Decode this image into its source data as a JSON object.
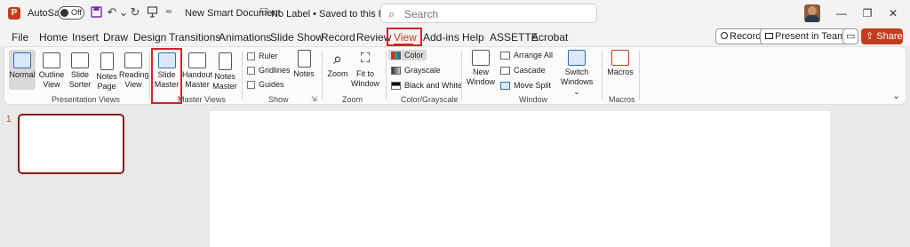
{
  "titlebar": {
    "app_icon": "powerpoint-icon",
    "autosave_label": "AutoSave",
    "autosave_state": "Off",
    "doc_title": "New Smart Document",
    "label_status": "No Label • Saved to this PC ⌄",
    "search_placeholder": "Search"
  },
  "tabs": [
    "File",
    "Home",
    "Insert",
    "Draw",
    "Design",
    "Transitions",
    "Animations",
    "Slide Show",
    "Record",
    "Review",
    "View",
    "Add-ins",
    "Help",
    "ASSETTE",
    "Acrobat"
  ],
  "active_tab": "View",
  "right_buttons": {
    "record": "Record",
    "present_in_teams": "Present in Teams",
    "share": "Share"
  },
  "ribbon": {
    "presentation_views": {
      "label": "Presentation Views",
      "normal": "Normal",
      "outline_view": [
        "Outline",
        "View"
      ],
      "slide_sorter": [
        "Slide",
        "Sorter"
      ],
      "notes_page": [
        "Notes",
        "Page"
      ],
      "reading_view": [
        "Reading",
        "View"
      ]
    },
    "master_views": {
      "label": "Master Views",
      "slide_master": [
        "Slide",
        "Master"
      ],
      "handout_master": [
        "Handout",
        "Master"
      ],
      "notes_master": [
        "Notes",
        "Master"
      ]
    },
    "show": {
      "label": "Show",
      "ruler": "Ruler",
      "gridlines": "Gridlines",
      "guides": "Guides",
      "notes": "Notes"
    },
    "zoom": {
      "label": "Zoom",
      "zoom": "Zoom",
      "fit_to_window": [
        "Fit to",
        "Window"
      ]
    },
    "color_grayscale": {
      "label": "Color/Grayscale",
      "color": "Color",
      "grayscale": "Grayscale",
      "black_and_white": "Black and White"
    },
    "window": {
      "label": "Window",
      "new_window": [
        "New",
        "Window"
      ],
      "arrange_all": "Arrange All",
      "cascade": "Cascade",
      "move_split": "Move Split",
      "switch_windows": [
        "Switch",
        "Windows ⌄"
      ]
    },
    "macros": {
      "label": "Macros",
      "macros": "Macros"
    }
  },
  "slides": {
    "thumbnail_number": "1"
  },
  "colors": {
    "accent": "#c43e1c",
    "highlight": "#d6212a"
  }
}
